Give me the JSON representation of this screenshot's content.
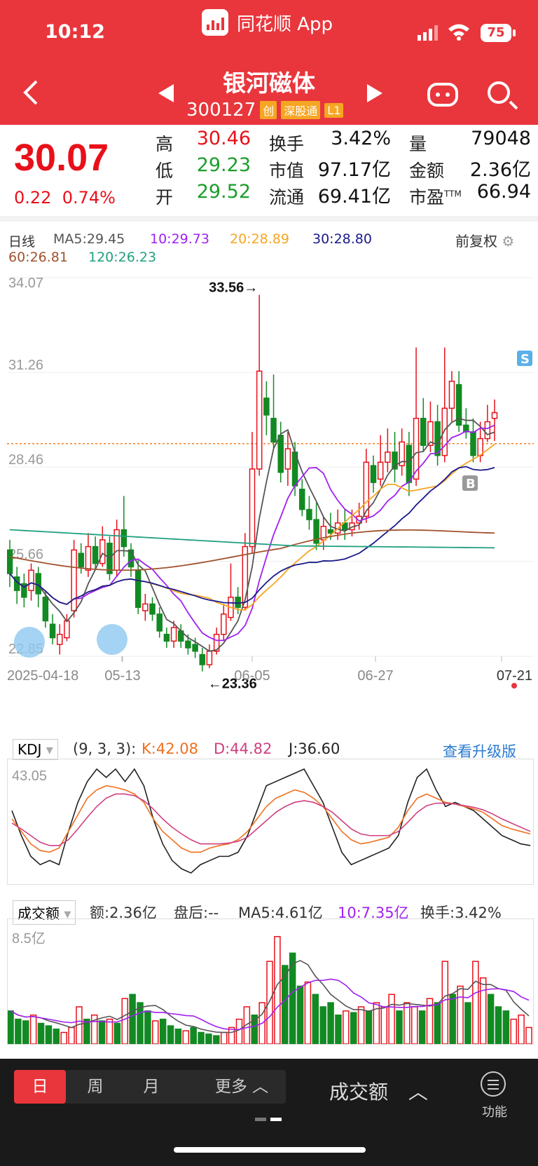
{
  "status": {
    "time": "10:12",
    "battery": "75",
    "app_name": "同花顺 App"
  },
  "header": {
    "title": "银河磁体",
    "code": "300127",
    "tags": [
      "创",
      "深股通",
      "L1"
    ]
  },
  "quote": {
    "price": "30.07",
    "change": "0.22",
    "change_pct": "0.74%",
    "items": [
      {
        "label": "高",
        "value": "30.46"
      },
      {
        "label": "低",
        "value": "29.23"
      },
      {
        "label": "开",
        "value": "29.52"
      },
      {
        "label": "换手",
        "value": "3.42%"
      },
      {
        "label": "市值",
        "value": "97.17亿"
      },
      {
        "label": "流通",
        "value": "69.41亿"
      },
      {
        "label": "量",
        "value": "79048"
      },
      {
        "label": "金额",
        "value": "2.36亿"
      },
      {
        "label": "市盈",
        "value": "66.94"
      }
    ],
    "ttm": "TTM"
  },
  "kline": {
    "period_label": "日线",
    "ma5": "MA5:29.45",
    "ma10": "10:29.73",
    "ma20": "20:28.89",
    "ma30": "30:28.80",
    "ma60": "60:26.81",
    "ma120": "120:26.23",
    "adjust": "前复权",
    "y_labels": [
      "34.07",
      "31.26",
      "28.46",
      "25.66",
      "22.85"
    ],
    "high_marker": "33.56→",
    "low_marker": "←23.36",
    "dates": [
      "2025-04-18",
      "05-13",
      "06-05",
      "06-27",
      "07-21"
    ],
    "sell_tag": "S",
    "buy_tag": "B",
    "colors": {
      "ma5": "#555555",
      "ma10": "#a020f0",
      "ma20": "#f5a623",
      "ma30": "#1a1a8c",
      "ma60": "#a0522d",
      "ma120": "#20a080"
    }
  },
  "kdj": {
    "name": "KDJ",
    "params": "(9, 3, 3):",
    "k": "K:42.08",
    "d": "D:44.82",
    "j": "J:36.60",
    "upgrade": "查看升级版",
    "y_label": "43.05"
  },
  "volume": {
    "name": "成交额",
    "amount": "额:2.36亿",
    "after": "盘后:--",
    "ma5": "MA5:4.61亿",
    "ma10": "10:7.35亿",
    "turnover": "换手:3.42%",
    "y_label": "8.5亿"
  },
  "bottom": {
    "periods": [
      "日",
      "周",
      "月",
      "更多"
    ],
    "indicator": "成交额",
    "func": "功能"
  },
  "chart_data": {
    "type": "candlestick",
    "title": "银河磁体",
    "x_labels": [
      "2025-04-18",
      "05-13",
      "06-05",
      "06-27",
      "07-21"
    ],
    "ylim": [
      22.85,
      34.07
    ],
    "marked_high": 33.56,
    "marked_low": 23.36,
    "last_close": 30.07
  }
}
